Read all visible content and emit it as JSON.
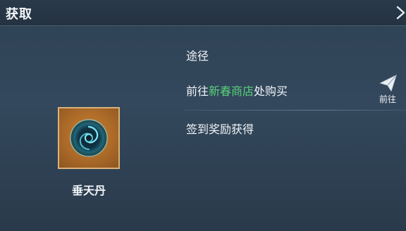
{
  "window": {
    "title": "获取",
    "close_icon": "close-x-icon"
  },
  "item": {
    "name": "垂天丹",
    "icon": "swirl-orb-icon",
    "frame_color": "#c9802f"
  },
  "sources": {
    "header": "途径",
    "routes": [
      {
        "prefix": "前往",
        "highlight": "新春商店",
        "suffix": "处购买",
        "action_label": "前往",
        "action_icon": "paper-plane-icon"
      },
      {
        "prefix": "签到奖励获得",
        "highlight": "",
        "suffix": ""
      }
    ]
  },
  "colors": {
    "highlight_text": "#58d27a",
    "panel_bg": "#2f4255"
  }
}
